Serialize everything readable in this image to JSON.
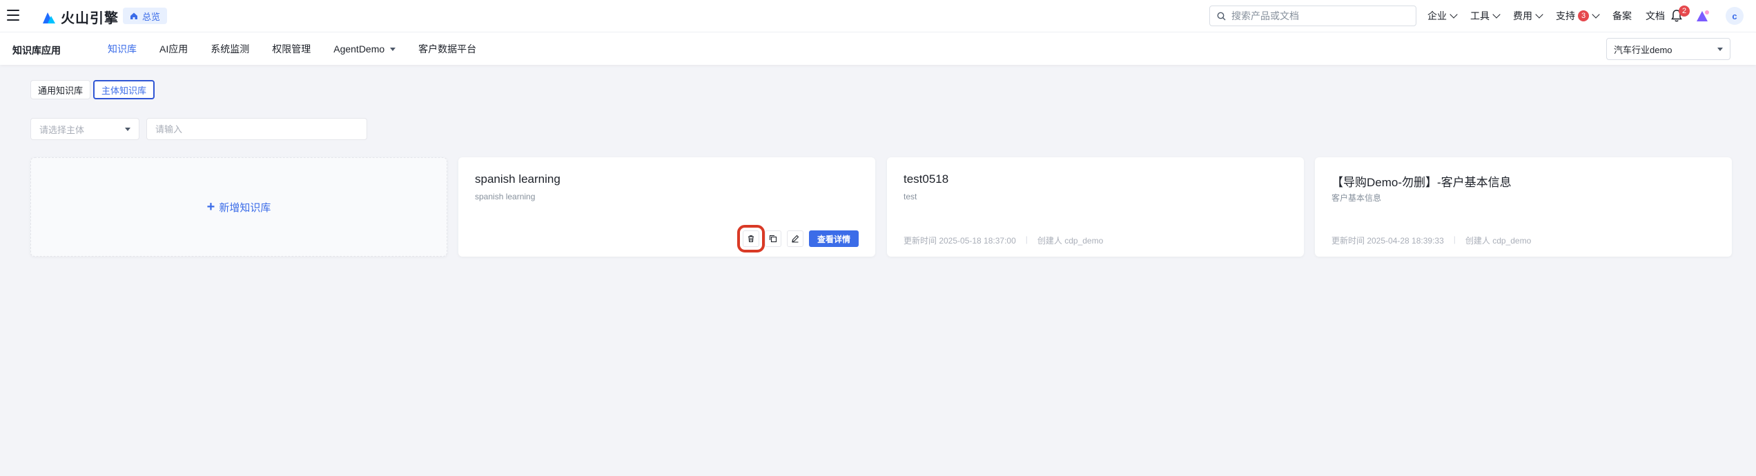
{
  "topbar": {
    "logo_text": "火山引擎",
    "overview_label": "总览",
    "search_placeholder": "搜索产品或文档",
    "nav": [
      {
        "label": "企业"
      },
      {
        "label": "工具"
      },
      {
        "label": "费用"
      },
      {
        "label": "支持",
        "badge": "3"
      },
      {
        "label": "备案"
      },
      {
        "label": "文档"
      }
    ],
    "notification_count": "2",
    "avatar_letter": "c"
  },
  "subbar": {
    "app_title": "知识库应用",
    "tabs": [
      {
        "label": "知识库",
        "active": true
      },
      {
        "label": "AI应用"
      },
      {
        "label": "系统监测"
      },
      {
        "label": "权限管理"
      },
      {
        "label": "AgentDemo"
      },
      {
        "label": "客户数据平台"
      }
    ],
    "industry_selected": "汽车行业demo"
  },
  "segments": [
    {
      "label": "通用知识库"
    },
    {
      "label": "主体知识库",
      "active": true
    }
  ],
  "filters": {
    "subject_placeholder": "请选择主体",
    "input_placeholder": "请输入"
  },
  "add_card": {
    "label": "新增知识库"
  },
  "cards": [
    {
      "title": "spanish learning",
      "description": "spanish learning",
      "view_label": "查看详情"
    },
    {
      "title": "test0518",
      "description": "test",
      "updated": "更新时间 2025-05-18 18:37:00",
      "creator": "创建人 cdp_demo"
    },
    {
      "title": "【导购Demo-勿删】-客户基本信息",
      "description": "客户基本信息",
      "updated": "更新时间 2025-04-28 18:39:33",
      "creator": "创建人 cdp_demo"
    }
  ],
  "colors": {
    "accent": "#3b6ce8",
    "highlight": "#d93a26",
    "background": "#f3f4f8"
  }
}
